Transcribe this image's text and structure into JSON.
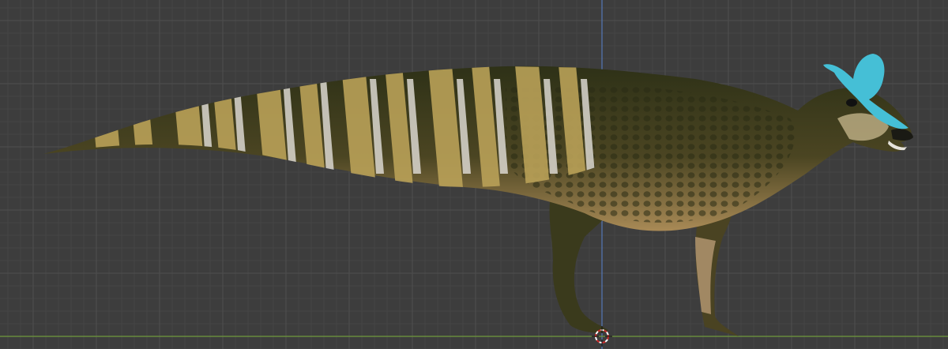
{
  "viewport": {
    "background_color": "#3d3d3d",
    "grid_minor_color": "#454545",
    "grid_major_color": "#4e4e4e",
    "y_axis_color": "#5578b8",
    "x_axis_color": "#6f9a3c",
    "grid_visible": true
  },
  "model": {
    "name_icon": "dinosaur-model",
    "crest_color": "#45bfd6",
    "body_dark_color": "#2e3117",
    "body_mid_color": "#4b4522",
    "stripe_light_color": "#b9a158",
    "stripe_white_color": "#dad7d0",
    "belly_color": "#a98a56"
  },
  "cursor": {
    "icon": "3d-cursor-icon",
    "color_a": "#cc2b2b",
    "color_b": "#ffffff"
  }
}
